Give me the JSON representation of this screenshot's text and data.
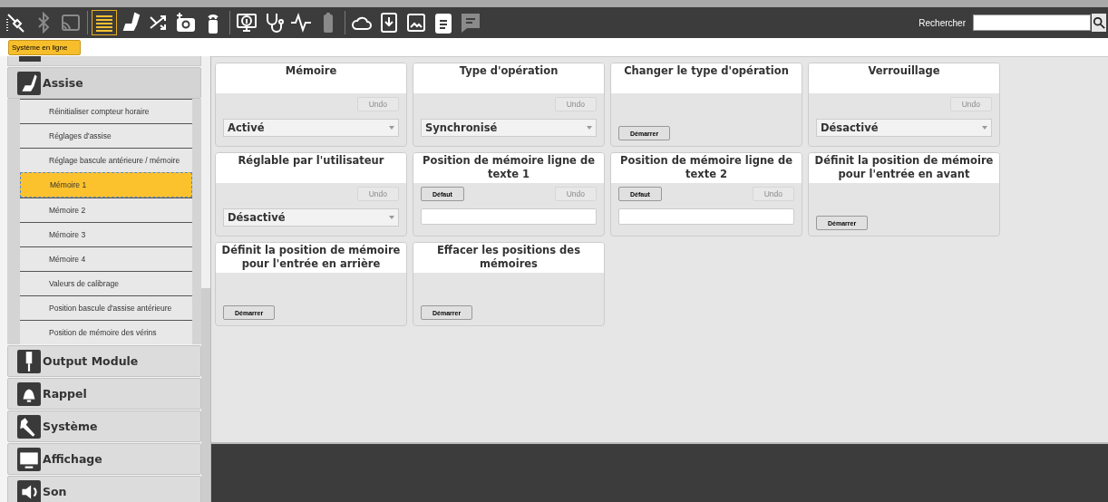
{
  "toolbar": {
    "tools": [
      {
        "kind": "plug",
        "selected": false,
        "disabled": false
      },
      {
        "kind": "bluetooth",
        "selected": false,
        "disabled": true
      },
      {
        "kind": "cast",
        "selected": false,
        "disabled": true
      },
      {
        "kind": "list",
        "selected": true,
        "disabled": false
      },
      {
        "kind": "seat",
        "selected": false,
        "disabled": false
      },
      {
        "kind": "shuffle",
        "selected": false,
        "disabled": false
      },
      {
        "kind": "camera",
        "selected": false,
        "disabled": false
      },
      {
        "kind": "remote",
        "selected": false,
        "disabled": false
      },
      {
        "kind": "monitor",
        "selected": false,
        "disabled": false
      },
      {
        "kind": "stethoscope",
        "selected": false,
        "disabled": false
      },
      {
        "kind": "pulse",
        "selected": false,
        "disabled": false
      },
      {
        "kind": "battery",
        "selected": false,
        "disabled": true
      },
      {
        "kind": "cloud",
        "selected": false,
        "disabled": false
      },
      {
        "kind": "download",
        "selected": false,
        "disabled": false
      },
      {
        "kind": "image",
        "selected": false,
        "disabled": false
      },
      {
        "kind": "clipboard",
        "selected": false,
        "disabled": false
      },
      {
        "kind": "chat",
        "selected": false,
        "disabled": true
      }
    ],
    "search": {
      "label": "Rechercher"
    }
  },
  "status_badge": "Système en ligne",
  "sidebar": {
    "sections": [
      {
        "label": "Assise",
        "expanded": true,
        "items": [
          {
            "label": "Réinitialiser compteur horaire",
            "selected": false
          },
          {
            "label": "Réglages d'assise",
            "selected": false
          },
          {
            "label": "Réglage bascule antérieure / mémoire",
            "selected": false
          },
          {
            "label": "Mémoire 1",
            "selected": true
          },
          {
            "label": "Mémoire 2",
            "selected": false
          },
          {
            "label": "Mémoire 3",
            "selected": false
          },
          {
            "label": "Mémoire 4",
            "selected": false
          },
          {
            "label": "Valeurs de calibrage",
            "selected": false
          },
          {
            "label": "Position bascule d'assise antérieure",
            "selected": false
          },
          {
            "label": "Position de mémoire des vérins",
            "selected": false
          }
        ]
      },
      {
        "label": "Output Module",
        "expanded": false
      },
      {
        "label": "Rappel",
        "expanded": false
      },
      {
        "label": "Système",
        "expanded": false
      },
      {
        "label": "Affichage",
        "expanded": false
      },
      {
        "label": "Son",
        "expanded": false
      }
    ]
  },
  "cards": [
    {
      "kind": "select",
      "title": "Mémoire",
      "undo": "Undo",
      "value": "Activé"
    },
    {
      "kind": "select",
      "title": "Type d'opération",
      "undo": "Undo",
      "value": "Synchronisé"
    },
    {
      "kind": "action",
      "title": "Changer le type d'opération",
      "button": "Démarrer"
    },
    {
      "kind": "select",
      "title": "Verrouillage",
      "undo": "Undo",
      "value": "Désactivé"
    },
    {
      "kind": "select",
      "title": "Réglable par l'utilisateur",
      "undo": "Undo",
      "value": "Désactivé"
    },
    {
      "kind": "text",
      "title": "Position de mémoire ligne de texte 1",
      "default": "Défaut",
      "undo": "Undo"
    },
    {
      "kind": "text",
      "title": "Position de mémoire ligne de texte 2",
      "default": "Défaut",
      "undo": "Undo"
    },
    {
      "kind": "action",
      "title": "Définit la position de mémoire pour l'entrée en avant",
      "button": "Démarrer"
    },
    {
      "kind": "action",
      "title": "Définit la position de mémoire pour l'entrée en arrière",
      "button": "Démarrer"
    },
    {
      "kind": "action",
      "title": "Effacer les positions des mémoires",
      "button": "Démarrer"
    }
  ]
}
